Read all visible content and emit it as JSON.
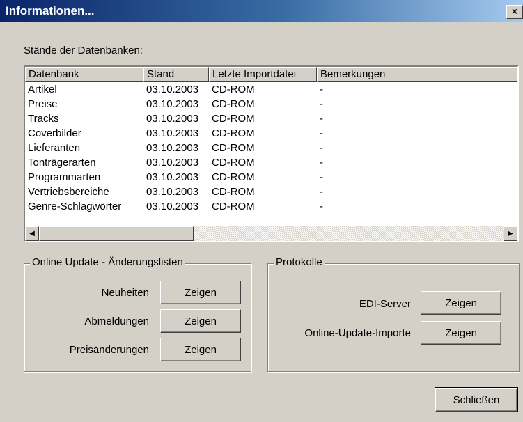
{
  "window": {
    "title": "Informationen...",
    "close_glyph": "×"
  },
  "section_label": "Stände der Datenbanken:",
  "table": {
    "columns": [
      "Datenbank",
      "Stand",
      "Letzte Importdatei",
      "Bemerkungen"
    ],
    "rows": [
      [
        "Artikel",
        "03.10.2003",
        "CD-ROM",
        "-"
      ],
      [
        "Preise",
        "03.10.2003",
        "CD-ROM",
        "-"
      ],
      [
        "Tracks",
        "03.10.2003",
        "CD-ROM",
        "-"
      ],
      [
        "Coverbilder",
        "03.10.2003",
        "CD-ROM",
        "-"
      ],
      [
        "Lieferanten",
        "03.10.2003",
        "CD-ROM",
        "-"
      ],
      [
        "Tonträgerarten",
        "03.10.2003",
        "CD-ROM",
        "-"
      ],
      [
        "Programmarten",
        "03.10.2003",
        "CD-ROM",
        "-"
      ],
      [
        "Vertriebsbereiche",
        "03.10.2003",
        "CD-ROM",
        "-"
      ],
      [
        "Genre-Schlagwörter",
        "03.10.2003",
        "CD-ROM",
        "-"
      ]
    ]
  },
  "online_update": {
    "title": "Online Update - Änderungslisten",
    "items": [
      {
        "label": "Neuheiten",
        "button": "Zeigen"
      },
      {
        "label": "Abmeldungen",
        "button": "Zeigen"
      },
      {
        "label": "Preisänderungen",
        "button": "Zeigen"
      }
    ]
  },
  "protokolle": {
    "title": "Protokolle",
    "items": [
      {
        "label": "EDI-Server",
        "button": "Zeigen"
      },
      {
        "label": "Online-Update-Importe",
        "button": "Zeigen"
      }
    ]
  },
  "close_button": "Schließen",
  "icons": {
    "scroll_left": "left-arrow-icon",
    "scroll_right": "right-arrow-icon"
  },
  "colors": {
    "title_start": "#0a246a",
    "title_end": "#a6caf0",
    "face": "#d4d0c8"
  }
}
